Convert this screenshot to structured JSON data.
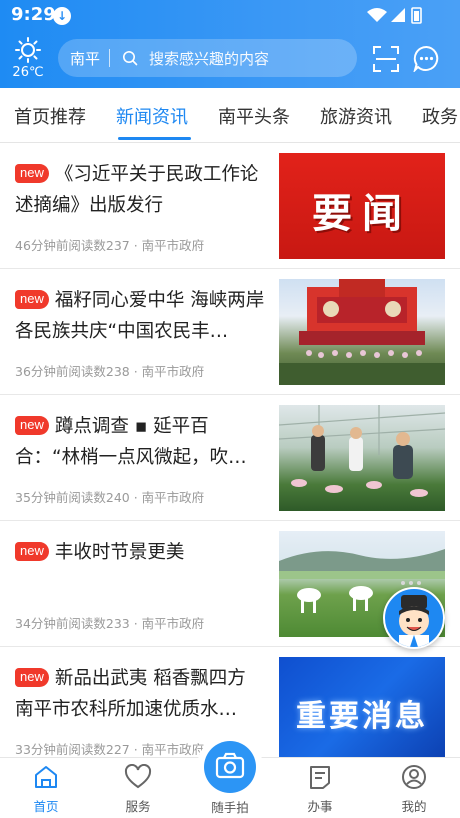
{
  "status_bar": {
    "time": "9:29"
  },
  "header": {
    "weather": {
      "icon": "sun-icon",
      "temperature": "26℃"
    },
    "search": {
      "city": "南平",
      "placeholder": "搜索感兴趣的内容"
    },
    "icons": [
      "scan-icon",
      "message-icon"
    ]
  },
  "tabs": [
    {
      "label": "首页推荐"
    },
    {
      "label": "新闻资讯",
      "active": true
    },
    {
      "label": "南平头条"
    },
    {
      "label": "旅游资讯"
    },
    {
      "label": "政务"
    }
  ],
  "news": [
    {
      "badge": "new",
      "title": "《习近平关于民政工作论述摘编》出版发行",
      "meta": "46分钟前阅读数237 · 南平市政府",
      "thumb_text": "要闻"
    },
    {
      "badge": "new",
      "title": "福籽同心爱中华 海峡两岸各民族共庆“中国农民丰…",
      "meta": "36分钟前阅读数238 · 南平市政府"
    },
    {
      "badge": "new",
      "title": "蹲点调查 ▪ 延平百合：“林梢一点风微起，吹…",
      "meta": "35分钟前阅读数240 · 南平市政府"
    },
    {
      "badge": "new",
      "title": "丰收时节景更美",
      "meta": "34分钟前阅读数233 · 南平市政府"
    },
    {
      "badge": "new",
      "title": "新品出武夷 稻香飘四方 南平市农科所加速优质水…",
      "meta": "33分钟前阅读数227 · 南平市政府",
      "thumb_text": "重要消息"
    }
  ],
  "bottom_nav": [
    {
      "label": "首页",
      "icon": "home-icon",
      "active": true
    },
    {
      "label": "服务",
      "icon": "heart-icon"
    },
    {
      "label": "随手拍",
      "icon": "camera-icon"
    },
    {
      "label": "办事",
      "icon": "document-icon"
    },
    {
      "label": "我的",
      "icon": "user-icon"
    }
  ],
  "colors": {
    "primary": "#1e88f2",
    "badge": "#f0392b"
  }
}
